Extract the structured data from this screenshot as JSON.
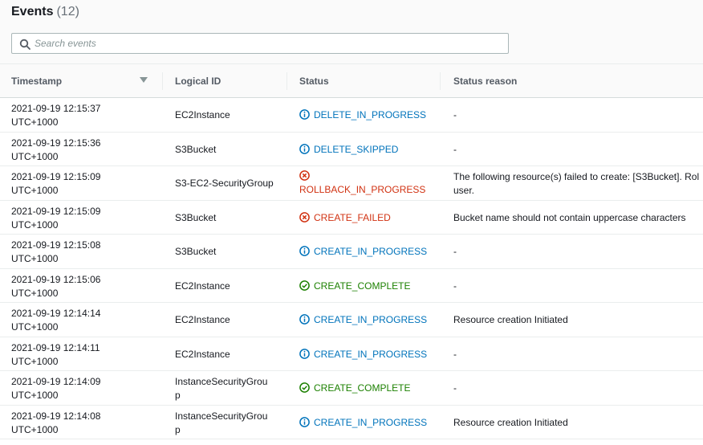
{
  "header": {
    "title": "Events",
    "count": "(12)"
  },
  "search": {
    "placeholder": "Search events",
    "value": ""
  },
  "columns": {
    "timestamp": "Timestamp",
    "logical_id": "Logical ID",
    "status": "Status",
    "status_reason": "Status reason"
  },
  "rows": [
    {
      "ts1": "2021-09-19 12:15:37",
      "ts2": "UTC+1000",
      "logical_id": "EC2Instance",
      "status": "DELETE_IN_PROGRESS",
      "status_type": "info",
      "reason": "-"
    },
    {
      "ts1": "2021-09-19 12:15:36",
      "ts2": "UTC+1000",
      "logical_id": "S3Bucket",
      "status": "DELETE_SKIPPED",
      "status_type": "info",
      "reason": "-"
    },
    {
      "ts1": "2021-09-19 12:15:09",
      "ts2": "UTC+1000",
      "logical_id": "S3-EC2-SecurityGroup",
      "status": "ROLLBACK_IN_PROGRESS",
      "status_type": "error",
      "reason": "The following resource(s) failed to create: [S3Bucket]. Rol",
      "reason2": "user."
    },
    {
      "ts1": "2021-09-19 12:15:09",
      "ts2": "UTC+1000",
      "logical_id": "S3Bucket",
      "status": "CREATE_FAILED",
      "status_type": "error",
      "reason": "Bucket name should not contain uppercase characters"
    },
    {
      "ts1": "2021-09-19 12:15:08",
      "ts2": "UTC+1000",
      "logical_id": "S3Bucket",
      "status": "CREATE_IN_PROGRESS",
      "status_type": "info",
      "reason": "-"
    },
    {
      "ts1": "2021-09-19 12:15:06",
      "ts2": "UTC+1000",
      "logical_id": "EC2Instance",
      "status": "CREATE_COMPLETE",
      "status_type": "success",
      "reason": "-"
    },
    {
      "ts1": "2021-09-19 12:14:14",
      "ts2": "UTC+1000",
      "logical_id": "EC2Instance",
      "status": "CREATE_IN_PROGRESS",
      "status_type": "info",
      "reason": "Resource creation Initiated"
    },
    {
      "ts1": "2021-09-19 12:14:11",
      "ts2": "UTC+1000",
      "logical_id": "EC2Instance",
      "status": "CREATE_IN_PROGRESS",
      "status_type": "info",
      "reason": "-"
    },
    {
      "ts1": "2021-09-19 12:14:09",
      "ts2": "UTC+1000",
      "logical_id": "InstanceSecurityGroup",
      "status": "CREATE_COMPLETE",
      "status_type": "success",
      "reason": "-"
    },
    {
      "ts1": "2021-09-19 12:14:08",
      "ts2": "UTC+1000",
      "logical_id": "InstanceSecurityGroup",
      "status": "CREATE_IN_PROGRESS",
      "status_type": "info",
      "reason": "Resource creation Initiated"
    }
  ],
  "icons": {
    "search": "search-icon",
    "sort": "sort-descending-icon",
    "info": "info-icon",
    "error": "error-icon",
    "success": "success-icon"
  },
  "colors": {
    "info": "#0073bb",
    "error": "#d13212",
    "success": "#1d8102",
    "header_text": "#545b64"
  }
}
